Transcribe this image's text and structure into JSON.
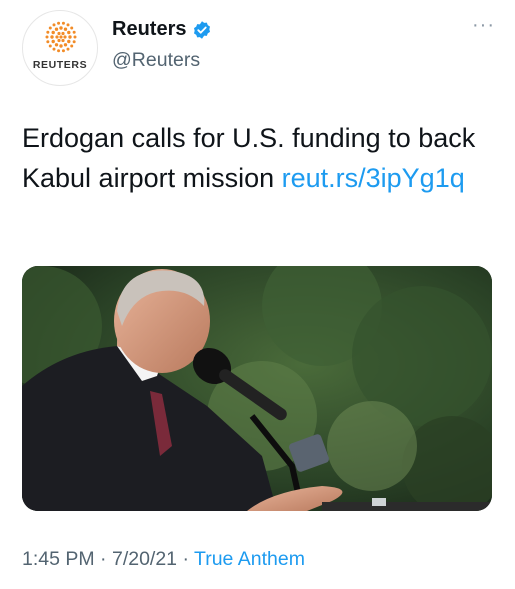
{
  "account": {
    "display_name": "Reuters",
    "handle": "@Reuters",
    "avatar_wordmark": "REUTERS",
    "verified": true
  },
  "menu": {
    "more_label": "···"
  },
  "tweet": {
    "text": "Erdogan calls for U.S. funding to back Kabul airport mission ",
    "link": "reut.rs/3ipYg1q"
  },
  "media": {
    "alt_description": "photo-of-speaker-at-microphone"
  },
  "meta": {
    "time": "1:45 PM",
    "separator": " · ",
    "date": "7/20/21",
    "source": "True Anthem"
  },
  "colors": {
    "accent": "#1d9bf0",
    "secondary_text": "#536471",
    "brand_orange": "#f28c28"
  }
}
